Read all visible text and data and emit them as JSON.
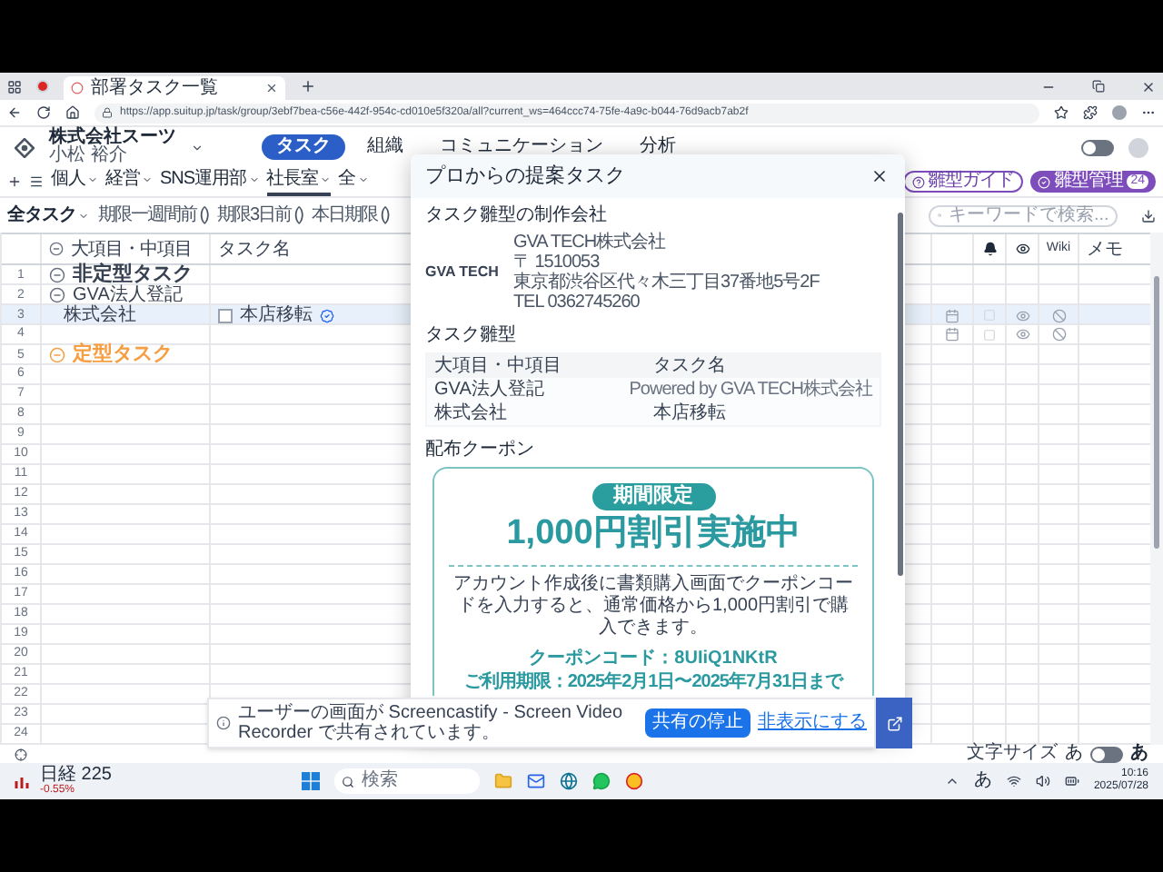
{
  "browser": {
    "tab_title": "部署タスク一覧",
    "url": "https://app.suitup.jp/task/group/3ebf7bea-c56e-442f-954c-cd010e5f320a/all?current_ws=464ccc74-75fe-4a9c-b044-76d9acb7ab2f"
  },
  "app_header": {
    "company": "株式会社スーツ",
    "user": "小松 裕介",
    "theme_toggle_on": false,
    "nav_tabs": [
      {
        "label": "タスク",
        "selected": true
      },
      {
        "label": "組織",
        "selected": false
      },
      {
        "label": "コミュニケーション",
        "selected": false
      },
      {
        "label": "分析",
        "selected": false
      }
    ]
  },
  "departments": [
    {
      "label": "個人",
      "selected": false
    },
    {
      "label": "経営",
      "selected": false
    },
    {
      "label": "SNS運用部",
      "selected": false
    },
    {
      "label": "社長室",
      "selected": true
    },
    {
      "label": "全",
      "selected": false
    }
  ],
  "template_guide": "雛型ガイド",
  "template_manage": "雛型管理",
  "template_count": "24",
  "filters": {
    "view": "全タスク",
    "chips": [
      "期限一週間前 ()",
      "期限3日前 ()",
      "本日期限 ()"
    ]
  },
  "search": {
    "placeholder": "キーワードで検索..."
  },
  "table": {
    "columns": [
      "大項目・中項目",
      "タスク名"
    ],
    "right_columns": [
      "Wiki",
      "メモ"
    ],
    "rows": [
      {
        "number": "1",
        "kind": "group",
        "label": "非定型タスク",
        "selected": false
      },
      {
        "number": "2",
        "kind": "subgroup",
        "label": "GVA法人登記",
        "selected": false
      },
      {
        "number": "3",
        "kind": "task",
        "label": "株式会社",
        "task": "本店移転",
        "checked": false,
        "selected": true
      },
      {
        "number": "4",
        "kind": "placeholder",
        "selected": false
      },
      {
        "number": "5",
        "kind": "regular",
        "label": "定型タスク",
        "selected": false
      },
      {
        "number": "6",
        "kind": "empty",
        "selected": false
      },
      {
        "number": "7",
        "kind": "empty",
        "selected": false
      },
      {
        "number": "8",
        "kind": "empty",
        "selected": false
      },
      {
        "number": "9",
        "kind": "empty",
        "selected": false
      },
      {
        "number": "10",
        "kind": "empty",
        "selected": false
      },
      {
        "number": "11",
        "kind": "empty",
        "selected": false
      },
      {
        "number": "12",
        "kind": "empty",
        "selected": false
      },
      {
        "number": "13",
        "kind": "empty",
        "selected": false
      },
      {
        "number": "14",
        "kind": "empty",
        "selected": false
      },
      {
        "number": "15",
        "kind": "empty",
        "selected": false
      },
      {
        "number": "16",
        "kind": "empty",
        "selected": false
      },
      {
        "number": "17",
        "kind": "empty",
        "selected": false
      },
      {
        "number": "18",
        "kind": "empty",
        "selected": false
      },
      {
        "number": "19",
        "kind": "empty",
        "selected": false
      },
      {
        "number": "20",
        "kind": "empty",
        "selected": false
      },
      {
        "number": "21",
        "kind": "empty",
        "selected": false
      },
      {
        "number": "22",
        "kind": "empty",
        "selected": false
      },
      {
        "number": "23",
        "kind": "empty",
        "selected": false
      },
      {
        "number": "24",
        "kind": "empty",
        "selected": false
      }
    ]
  },
  "modal": {
    "title": "プロからの提案タスク",
    "maker_heading": "タスク雛型の制作会社",
    "maker_logo": "GVA TECH",
    "maker_lines": [
      "GVA TECH株式会社",
      "〒 1510053",
      "東京都渋谷区代々木三丁目37番地5号2F",
      "TEL 0362745260"
    ],
    "template_heading": "タスク雛型",
    "template_columns": [
      "大項目・中項目",
      "タスク名"
    ],
    "template_rows": [
      {
        "category": "GVA法人登記",
        "credit": "Powered by GVA TECH株式会社"
      },
      {
        "category": "株式会社",
        "task": "本店移転"
      }
    ],
    "coupon_heading": "配布クーポン",
    "coupon": {
      "badge": "期間限定",
      "headline": "1,000円割引実施中",
      "description": "アカウント作成後に書類購入画面でクーポンコードを入力すると、通常価格から1,000円割引で購入できます。",
      "code": "クーポンコード：8UIiQ1NKtR",
      "period": "ご利用期限：2025年2月1日〜2025年7月31日まで"
    }
  },
  "share_bar": {
    "message": "ユーザーの画面が Screencastify - Screen Video Recorder で共有されています。",
    "stop": "共有の停止",
    "hide": "非表示にする"
  },
  "status_bar": {
    "font_size_label": "文字サイズ",
    "small": "あ",
    "large": "あ",
    "toggle_on": false
  },
  "taskbar": {
    "stock_name": "日経 225",
    "stock_change": "-0.55%",
    "search_placeholder": "検索",
    "ime": "あ",
    "time": "10:16",
    "date": "2025/07/28"
  }
}
